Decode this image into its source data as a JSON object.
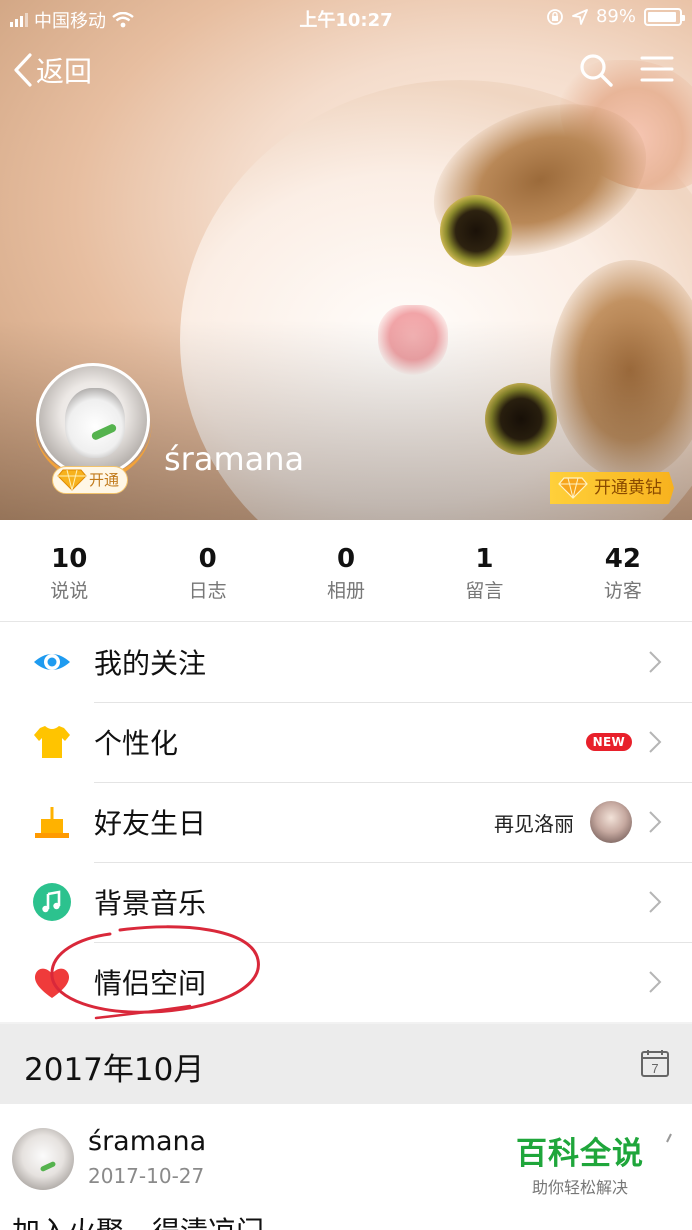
{
  "status_bar": {
    "carrier": "中国移动",
    "time": "上午10:27",
    "battery": "89%"
  },
  "nav": {
    "back_label": "返回"
  },
  "profile": {
    "username": "śramana",
    "open_badge": "开通",
    "yellow_diamond_badge": "开通黄钻"
  },
  "stats": [
    {
      "value": "10",
      "label": "说说"
    },
    {
      "value": "0",
      "label": "日志"
    },
    {
      "value": "0",
      "label": "相册"
    },
    {
      "value": "1",
      "label": "留言"
    },
    {
      "value": "42",
      "label": "访客"
    }
  ],
  "menu": [
    {
      "label": "我的关注",
      "icon": "eye-icon"
    },
    {
      "label": "个性化",
      "icon": "tshirt-icon",
      "badge": "NEW"
    },
    {
      "label": "好友生日",
      "icon": "cake-icon",
      "friend": "再见洛丽"
    },
    {
      "label": "背景音乐",
      "icon": "music-icon"
    },
    {
      "label": "情侣空间",
      "icon": "heart-icon"
    }
  ],
  "feed": {
    "date_header": "2017年10月",
    "calendar_day": "7",
    "post": {
      "author": "śramana",
      "date": "2017-10-27",
      "text": "加入火聚，得清凉门"
    }
  },
  "watermark": {
    "title": "百科全说",
    "subtitle": "助你轻松解决"
  },
  "colors": {
    "eye_blue": "#1e9bf0",
    "shirt_yellow": "#ffc400",
    "cake_orange": "#ffb200",
    "music_green": "#2cc28e",
    "heart_red": "#ef3b3b",
    "new_red": "#e8202b",
    "annotation_red": "#d9283a",
    "watermark_green": "#1fa63b"
  }
}
